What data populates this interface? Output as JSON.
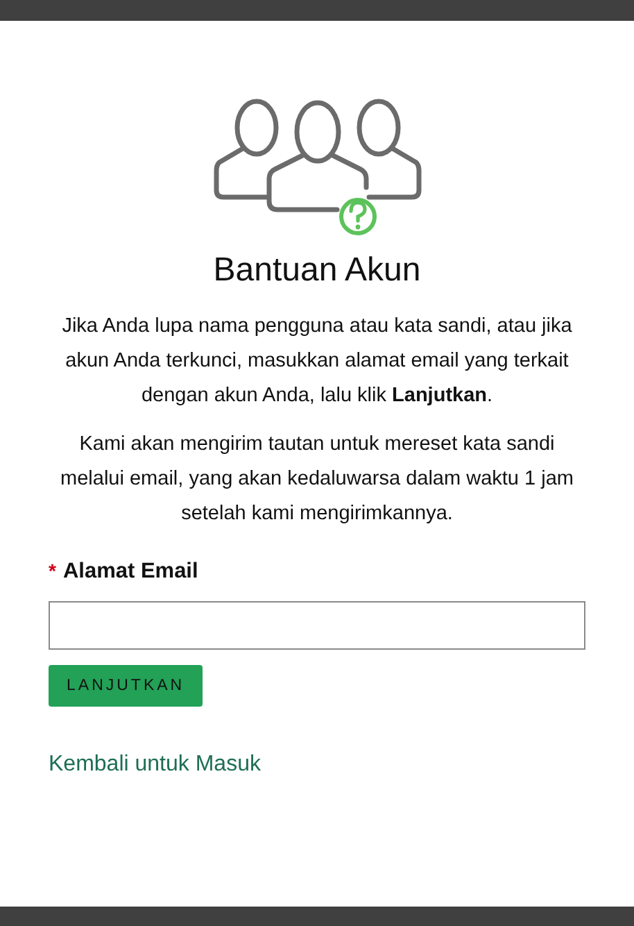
{
  "title": "Bantuan Akun",
  "paragraphs": [
    "Jika Anda lupa nama pengguna atau kata sandi, atau jika akun Anda terkunci, masukkan alamat email yang terkait dengan akun Anda, lalu klik **Lanjutkan**.",
    "Kami akan mengirim tautan untuk mereset kata sandi melalui email, yang akan kedaluwarsa dalam waktu 1 jam setelah kami mengirimkannya."
  ],
  "email_field": {
    "required_mark": "*",
    "label": "Alamat Email"
  },
  "submit_button": "LANJUTKAN",
  "back_link": "Kembali untuk Masuk"
}
